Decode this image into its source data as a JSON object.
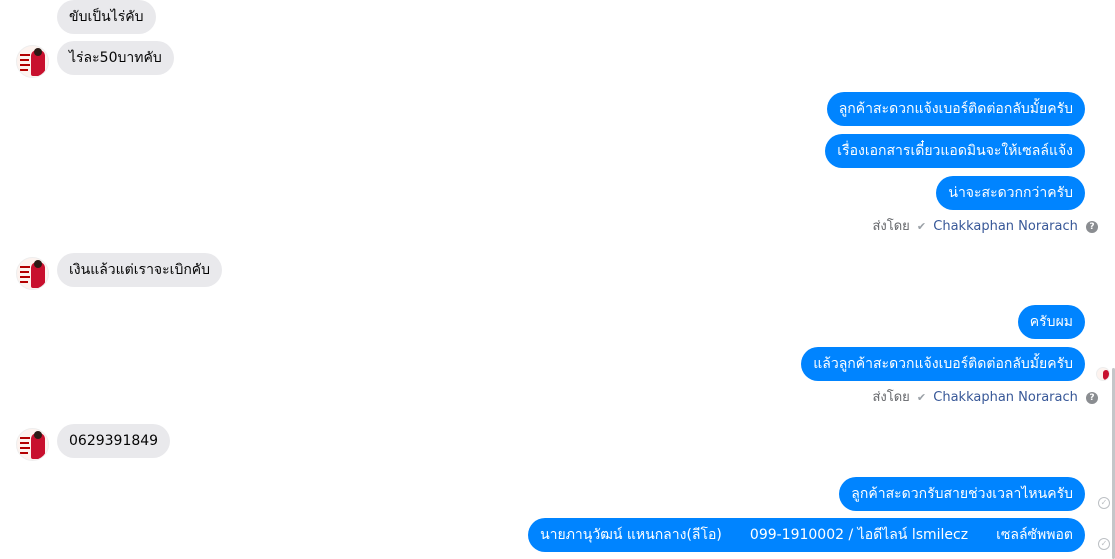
{
  "messages": {
    "m1": "ขับเป็นไร่คับ",
    "m2": "ไร่ละ50บาทคับ",
    "m3": "ลูกค้าสะดวกแจ้งเบอร์ติดต่อกลับมั้ยครับ",
    "m4": "เรื่องเอกสารเดี๋ยวแอดมินจะให้เซลล์แจ้ง",
    "m5": "น่าจะสะดวกกว่าครับ",
    "m6": "เงินแล้วแต่เราจะเบิกคับ",
    "m7": "ครับผม",
    "m8": "แล้วลูกค้าสะดวกแจ้งเบอร์ติดต่อกลับมั้ยครับ",
    "m9": "0629391849",
    "m10": "ลูกค้าสะดวกรับสายช่วงเวลาไหนครับ",
    "m11": {
      "part1": "นายภานุวัฒน์ แหนกลาง(ลีโอ)",
      "part2": "099-1910002 / ไอดีไลน์ lsmilecz",
      "part3": "เซลล์ซัพพอต"
    }
  },
  "sent_by": {
    "prefix": "ส่งโดย",
    "name": "Chakkaphan Norarach",
    "help": "?"
  },
  "icons": {
    "verified": "check-circle-icon",
    "help": "question-icon",
    "seen": "check-circle-icon"
  },
  "colors": {
    "outgoing": "#0084ff",
    "incoming": "#e9e9ec",
    "link": "#385898"
  }
}
